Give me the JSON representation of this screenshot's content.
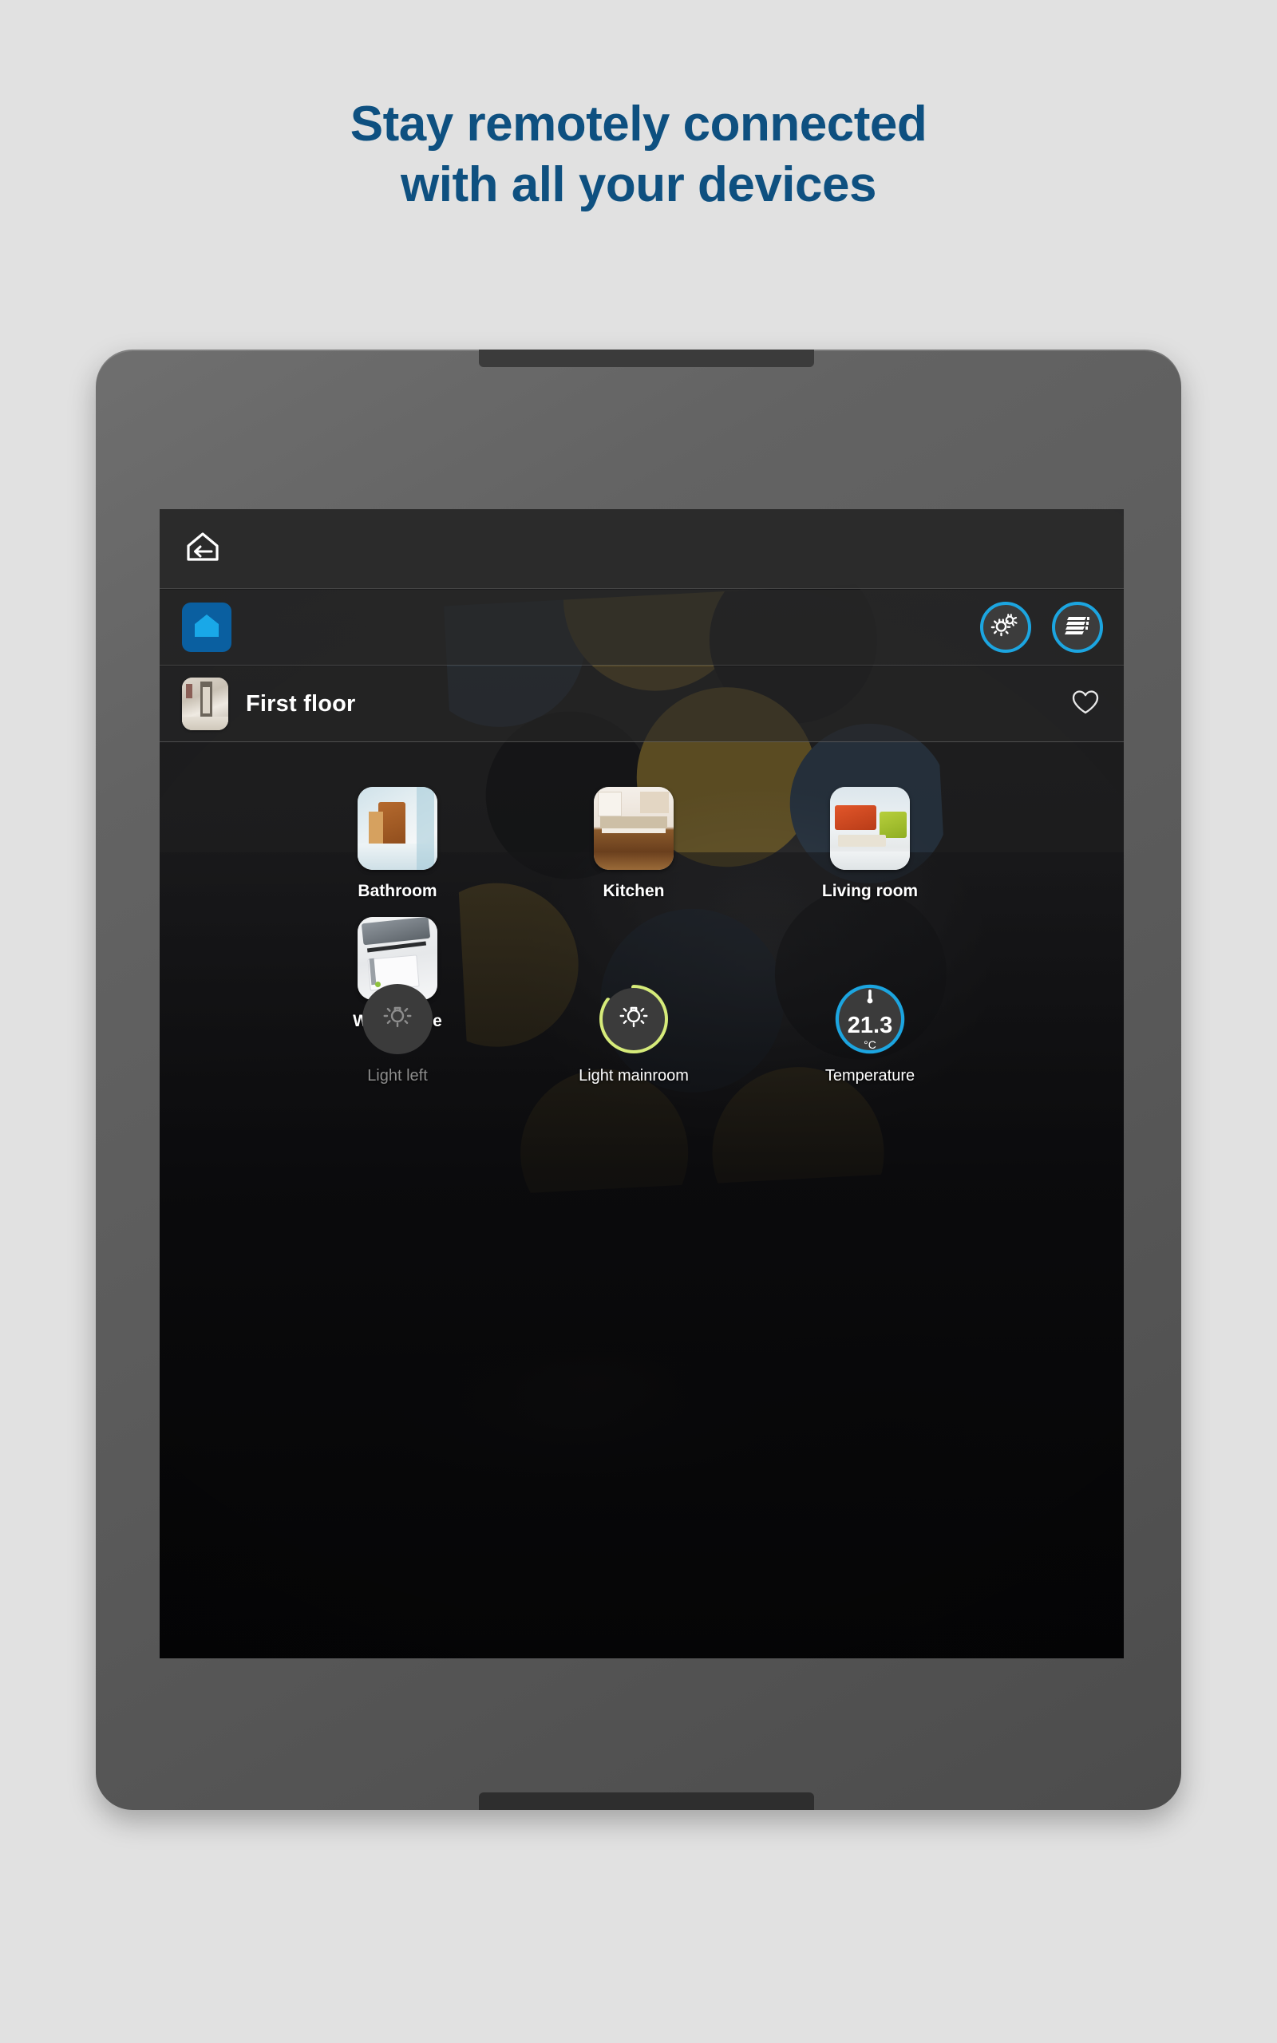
{
  "headline": {
    "line1": "Stay remotely connected",
    "line2": "with all your devices",
    "color": "#0e5080"
  },
  "device_frame": {
    "type": "tablet",
    "bezel_color": "#5d5d5d",
    "camera_icon": "camera-dot"
  },
  "app": {
    "topbar": {
      "back_icon": "house-back-arrow-icon"
    },
    "homebar": {
      "home_icon": "house-icon",
      "home_button_color": "#0a5fa0",
      "accent_color": "#1ca5e0",
      "actions": [
        {
          "icon": "lights-group-icon",
          "name": "lights-shortcut"
        },
        {
          "icon": "blinds-icon",
          "name": "blinds-shortcut"
        }
      ]
    },
    "floorbar": {
      "title": "First floor",
      "thumbnail": "hallway-photo",
      "favorite_icon": "heart-outline-icon",
      "favorite_active": false
    },
    "rooms": [
      {
        "label": "Bathroom",
        "thumbnail": "bathroom-photo"
      },
      {
        "label": "Kitchen",
        "thumbnail": "kitchen-photo"
      },
      {
        "label": "Living room",
        "thumbnail": "livingroom-photo"
      },
      {
        "label": "Workspace",
        "thumbnail": "workspace-photo"
      }
    ],
    "devices": [
      {
        "label": "Light left",
        "type": "light",
        "state": "off",
        "icon": "light-bulb-icon",
        "ring_percent": 0,
        "ring_color": "none",
        "icon_color": "#8d8d8d",
        "value": "",
        "unit": ""
      },
      {
        "label": "Light mainroom",
        "type": "light",
        "state": "on",
        "icon": "light-bulb-icon",
        "ring_percent": 85,
        "ring_color": "#d6eb7a",
        "icon_color": "#ffffff",
        "value": "",
        "unit": ""
      },
      {
        "label": "Temperature",
        "type": "thermometer",
        "state": "on",
        "icon": "thermometer-icon",
        "ring_percent": 100,
        "ring_color": "#1ca5e0",
        "icon_color": "#ffffff",
        "value": "21.3",
        "unit": "°C"
      }
    ]
  }
}
